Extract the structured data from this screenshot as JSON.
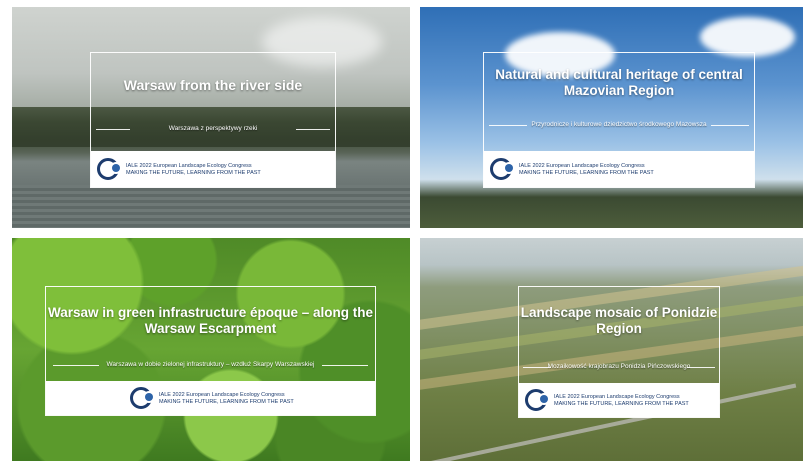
{
  "tiles": [
    {
      "title": "Warsaw from the river side",
      "subtitle": "Warszawa z perspektywy rzeki"
    },
    {
      "title": "Natural and cultural heritage of central Mazovian Region",
      "subtitle": "Przyrodnicze i kulturowe dziedzictwo środkowego Mazowsza"
    },
    {
      "title": "Warsaw in green infrastructure époque – along the Warsaw Escarpment",
      "subtitle": "Warszawa w dobie zielonej infrastruktury – wzdłuż Skarpy Warszawskiej"
    },
    {
      "title": "Landscape mosaic of Ponidzie Region",
      "subtitle": "Mozaikowość krajobrazu Ponidzia Pińczowskiego"
    }
  ],
  "congress": {
    "name": "IALE 2022 European Landscape Ecology Congress",
    "motto": "MAKING THE FUTURE, LEARNING FROM THE PAST",
    "logo_icon": "iale-logo-icon"
  },
  "colors": {
    "brand": "#1d3c6e",
    "accent": "#2d63a8"
  }
}
